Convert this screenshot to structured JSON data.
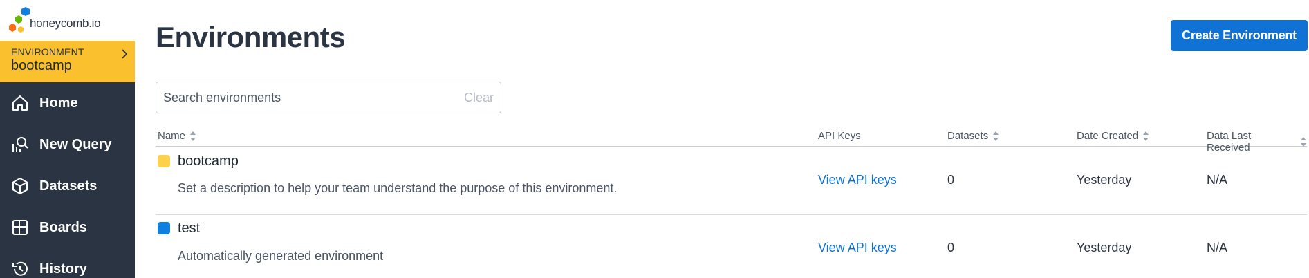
{
  "brand": {
    "name": "honeycomb.io"
  },
  "environment_switcher": {
    "label": "ENVIRONMENT",
    "name": "bootcamp"
  },
  "nav": [
    {
      "label": "Home",
      "icon": "home-icon"
    },
    {
      "label": "New Query",
      "icon": "query-icon"
    },
    {
      "label": "Datasets",
      "icon": "cube-icon"
    },
    {
      "label": "Boards",
      "icon": "boards-icon"
    },
    {
      "label": "History",
      "icon": "history-icon"
    }
  ],
  "page": {
    "title": "Environments",
    "create_button": "Create Environment"
  },
  "search": {
    "placeholder": "Search environments",
    "clear_label": "Clear"
  },
  "table": {
    "columns": [
      "Name",
      "API Keys",
      "Datasets",
      "Date Created",
      "Data Last Received"
    ],
    "rows": [
      {
        "name": "bootcamp",
        "color": "#fdd14a",
        "description": "Set a description to help your team understand the purpose of this environment.",
        "api_keys": "View API keys",
        "datasets": "0",
        "date_created": "Yesterday",
        "last_received": "N/A"
      },
      {
        "name": "test",
        "color": "#0f7fe0",
        "description": "Automatically generated environment",
        "api_keys": "View API keys",
        "datasets": "0",
        "date_created": "Yesterday",
        "last_received": "N/A"
      }
    ]
  },
  "colors": {
    "sidebar_bg": "#2b3442",
    "env_bar": "#fbc02d",
    "accent": "#0f72d4"
  }
}
